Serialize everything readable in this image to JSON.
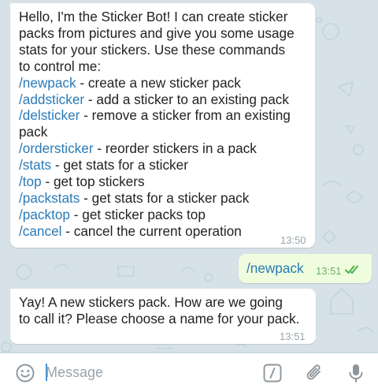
{
  "messages": [
    {
      "from": "bot",
      "lines": [
        [
          {
            "t": "Hello, I'm the Sticker Bot! I can create sticker"
          }
        ],
        [
          {
            "t": "packs from pictures and give you some usage"
          }
        ],
        [
          {
            "t": "stats for your stickers. Use these commands"
          }
        ],
        [
          {
            "t": "to control me:"
          }
        ],
        [
          {
            "t": "/newpack",
            "cmd": true
          },
          {
            "t": " - create a new sticker pack"
          }
        ],
        [
          {
            "t": "/addsticker",
            "cmd": true
          },
          {
            "t": " - add a sticker to an existing pack"
          }
        ],
        [
          {
            "t": "/delsticker",
            "cmd": true
          },
          {
            "t": " - remove a sticker from an existing"
          }
        ],
        [
          {
            "t": "pack"
          }
        ],
        [
          {
            "t": "/ordersticker",
            "cmd": true
          },
          {
            "t": " - reorder stickers in a pack"
          }
        ],
        [
          {
            "t": "/stats",
            "cmd": true
          },
          {
            "t": " - get stats for a sticker"
          }
        ],
        [
          {
            "t": "/top",
            "cmd": true
          },
          {
            "t": " - get top stickers"
          }
        ],
        [
          {
            "t": "/packstats",
            "cmd": true
          },
          {
            "t": " - get stats for a sticker pack"
          }
        ],
        [
          {
            "t": "/packtop",
            "cmd": true
          },
          {
            "t": " - get sticker packs top"
          }
        ],
        [
          {
            "t": "/cancel",
            "cmd": true
          },
          {
            "t": " - cancel the current operation"
          }
        ]
      ],
      "time": "13:50"
    },
    {
      "from": "me",
      "text": "/newpack",
      "time": "13:51",
      "status": "read"
    },
    {
      "from": "bot",
      "lines": [
        [
          {
            "t": "Yay! A new stickers pack. How are we going"
          }
        ],
        [
          {
            "t": "to call it? Please choose a name for your pack."
          }
        ]
      ],
      "time": "13:51"
    }
  ],
  "input": {
    "placeholder": "Message",
    "value": "",
    "icons": [
      "emoji-icon",
      "commands-icon",
      "attach-icon",
      "microphone-icon"
    ]
  },
  "colors": {
    "link": "#2a7ab8",
    "outgoing_bubble": "#effdde",
    "read_check": "#4caf50",
    "chat_background": "#d6e2e8"
  }
}
